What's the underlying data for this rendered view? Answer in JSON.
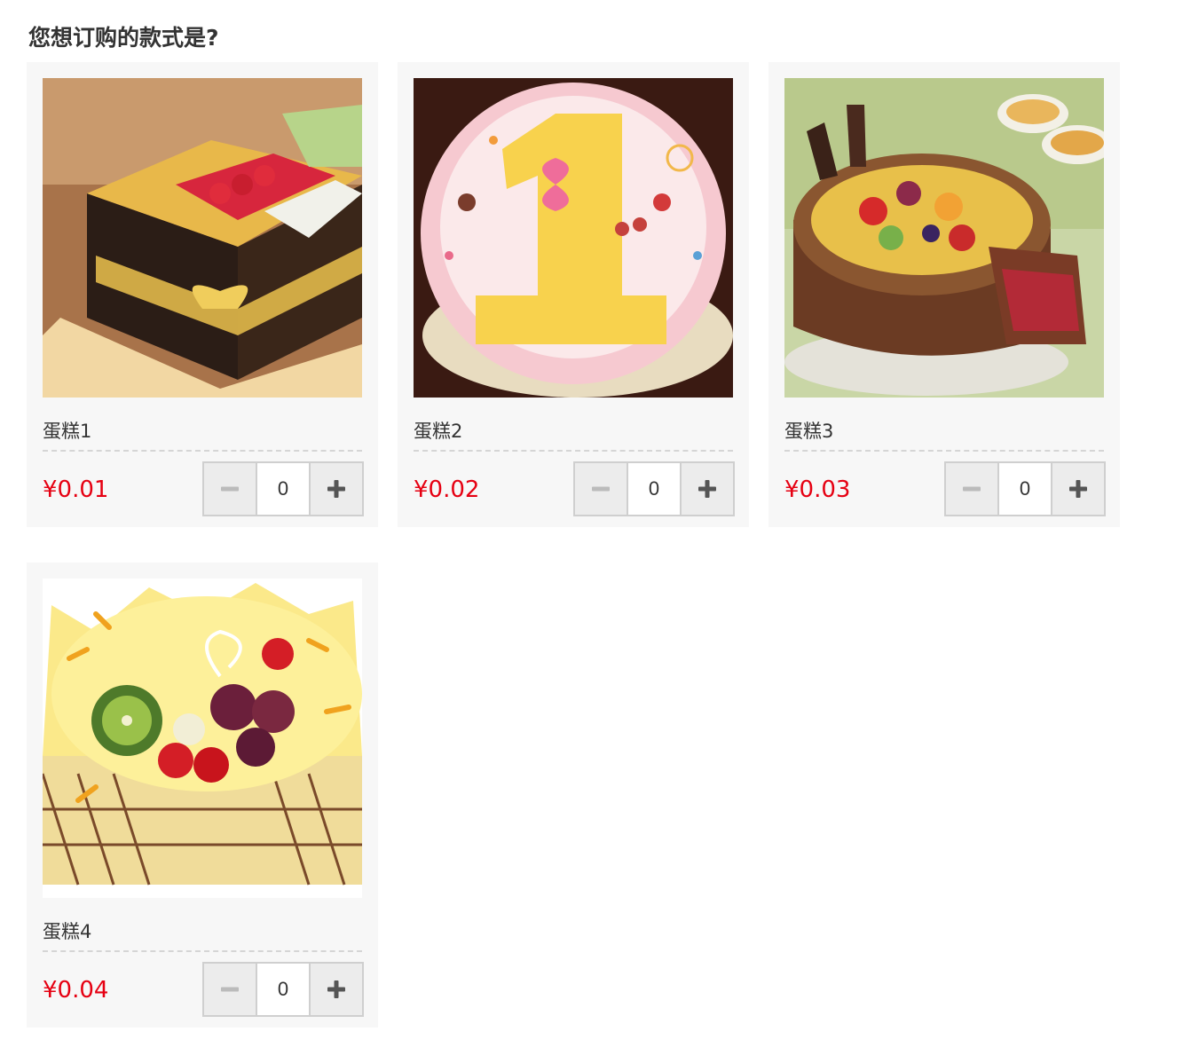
{
  "question": "您想订购的款式是?",
  "currency_symbol": "¥",
  "products": [
    {
      "name": "蛋糕1",
      "price": "¥0.01",
      "quantity": "0",
      "image": "fruit-box-cake"
    },
    {
      "name": "蛋糕2",
      "price": "¥0.02",
      "quantity": "0",
      "image": "number-one-birthday-cake"
    },
    {
      "name": "蛋糕3",
      "price": "¥0.03",
      "quantity": "0",
      "image": "chocolate-fruit-cake"
    },
    {
      "name": "蛋糕4",
      "price": "¥0.04",
      "quantity": "0",
      "image": "mango-fruit-cake"
    }
  ],
  "colors": {
    "price": "#e60012",
    "card_background": "#f7f7f7",
    "stepper_button": "#ececec",
    "minus_icon": "#bbbbbb",
    "plus_icon": "#555555"
  },
  "icons": {
    "decrease": "minus-icon",
    "increase": "plus-icon"
  }
}
